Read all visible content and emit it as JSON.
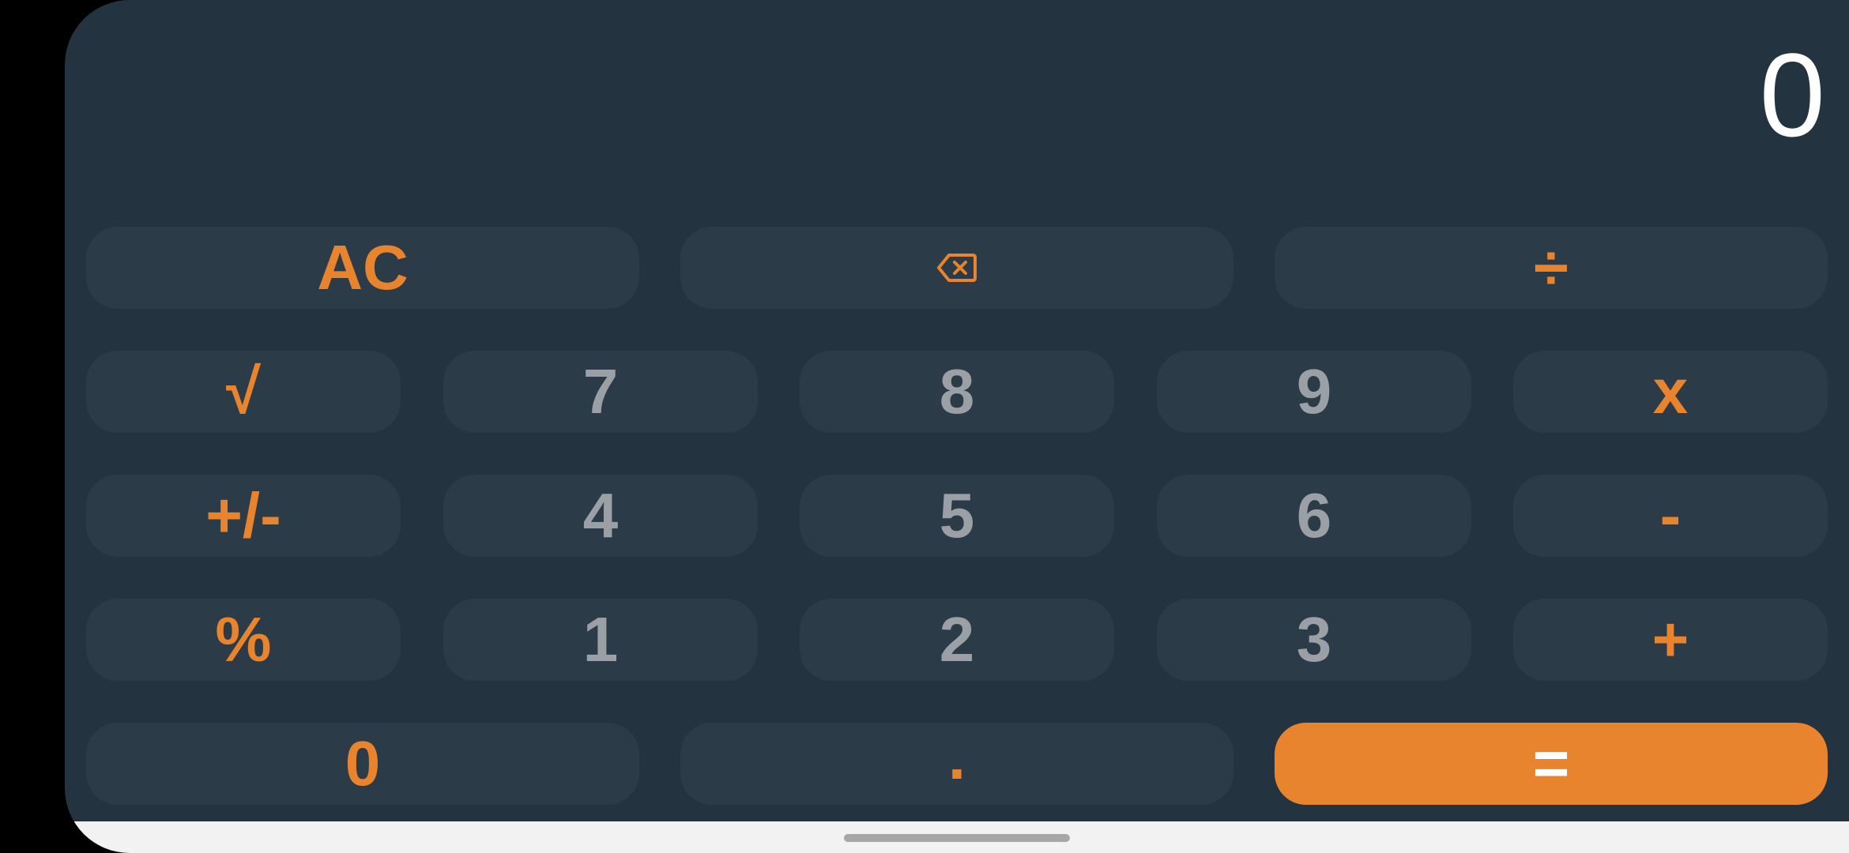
{
  "display": {
    "value": "0"
  },
  "colors": {
    "background": "#243340",
    "key": "#2c3b48",
    "accent": "#e8832e",
    "digit": "#9aa0a6",
    "display_text": "#ffffff"
  },
  "keypad": {
    "row1": {
      "clear": "AC",
      "backspace_icon": "backspace-icon",
      "divide": "÷"
    },
    "row2": {
      "sqrt": "√",
      "seven": "7",
      "eight": "8",
      "nine": "9",
      "multiply": "x"
    },
    "row3": {
      "sign": "+/-",
      "four": "4",
      "five": "5",
      "six": "6",
      "minus": "-"
    },
    "row4": {
      "percent": "%",
      "one": "1",
      "two": "2",
      "three": "3",
      "plus": "+"
    },
    "row5": {
      "zero": "0",
      "decimal": ".",
      "equals": "="
    }
  }
}
